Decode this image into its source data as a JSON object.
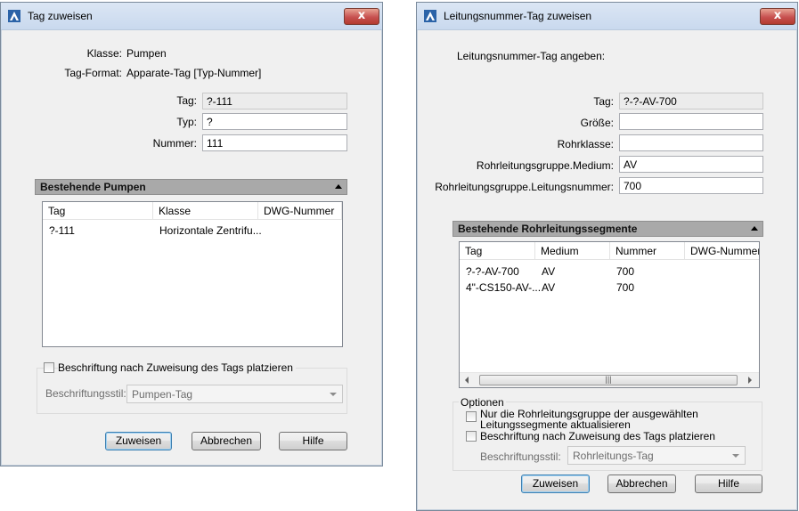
{
  "dialog1": {
    "title": "Tag zuweisen",
    "close_label": "x",
    "klasse_label": "Klasse:",
    "klasse_value": "Pumpen",
    "tagformat_label": "Tag-Format:",
    "tagformat_value": "Apparate-Tag [Typ-Nummer]",
    "tag_label": "Tag:",
    "tag_value": "?-111",
    "typ_label": "Typ:",
    "typ_value": "?",
    "nummer_label": "Nummer:",
    "nummer_value": "111",
    "section_title": "Bestehende Pumpen",
    "columns": [
      "Tag",
      "Klasse",
      "DWG-Nummer"
    ],
    "rows": [
      [
        "?-111",
        "Horizontale Zentrifu...",
        ""
      ]
    ],
    "checkbox_label": "Beschriftung nach Zuweisung des Tags platzieren",
    "style_label": "Beschriftungsstil:",
    "style_value": "Pumpen-Tag",
    "buttons": {
      "assign": "Zuweisen",
      "cancel": "Abbrechen",
      "help": "Hilfe"
    }
  },
  "dialog2": {
    "title": "Leitungsnummer-Tag zuweisen",
    "close_label": "x",
    "intro": "Leitungsnummer-Tag angeben:",
    "tag_label": "Tag:",
    "tag_value": "?-?-AV-700",
    "groesse_label": "Größe:",
    "groesse_value": "",
    "rohrklasse_label": "Rohrklasse:",
    "rohrklasse_value": "",
    "medium_label": "Rohrleitungsgruppe.Medium:",
    "medium_value": "AV",
    "lnummer_label": "Rohrleitungsgruppe.Leitungsnummer:",
    "lnummer_value": "700",
    "section_title": "Bestehende Rohrleitungssegmente",
    "columns": [
      "Tag",
      "Medium",
      "Nummer",
      "DWG-Nummer"
    ],
    "rows": [
      [
        "?-?-AV-700",
        "AV",
        "700",
        ""
      ],
      [
        "4\"-CS150-AV-...",
        "AV",
        "700",
        ""
      ]
    ],
    "options_title": "Optionen",
    "option1_line1": "Nur die Rohrleitungsgruppe der ausgewählten",
    "option1_line2": "Leitungssegmente aktualisieren",
    "option2": "Beschriftung nach Zuweisung des Tags platzieren",
    "style_label": "Beschriftungsstil:",
    "style_value": "Rohrleitungs-Tag",
    "buttons": {
      "assign": "Zuweisen",
      "cancel": "Abbrechen",
      "help": "Hilfe"
    }
  }
}
